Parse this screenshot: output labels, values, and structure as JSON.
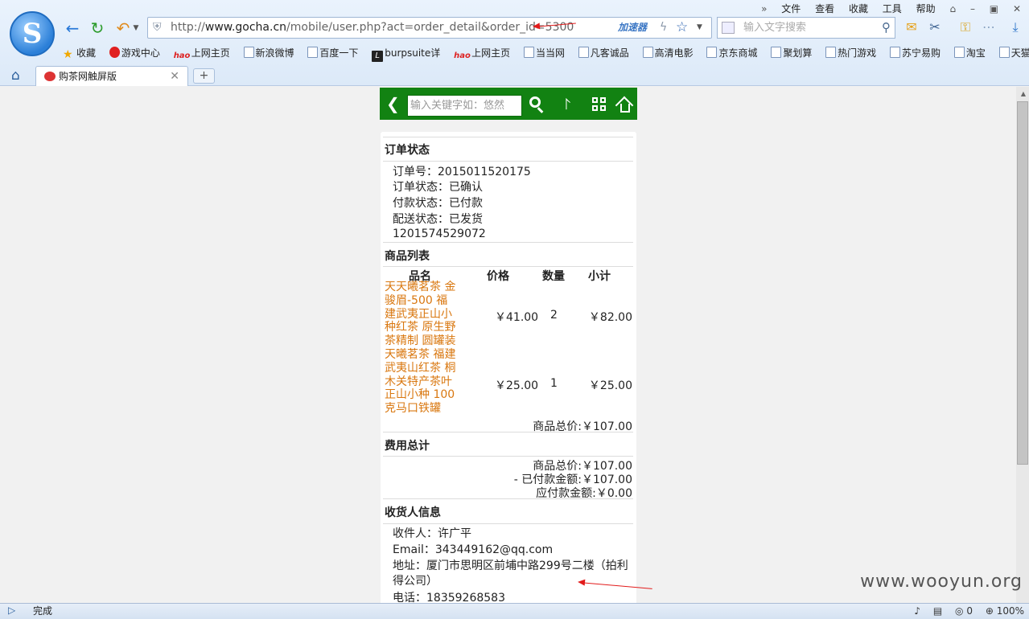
{
  "browser": {
    "logo_letter": "S",
    "url": {
      "scheme": "http://",
      "host": "www.gocha.cn",
      "path": "/mobile/user.php?act=order_detail&order_id=5300"
    },
    "accelerator_label": "加速器",
    "search_placeholder": "输入文字搜索",
    "menu": [
      "文件",
      "查看",
      "收藏",
      "工具",
      "帮助"
    ],
    "favorites": [
      {
        "label": "收藏",
        "icon": "star-icon"
      },
      {
        "label": "游戏中心",
        "icon": "game-icon"
      },
      {
        "label": "上网主页",
        "icon": "hao-icon"
      },
      {
        "label": "新浪微博",
        "icon": "page-icon"
      },
      {
        "label": "百度一下",
        "icon": "page-icon"
      },
      {
        "label": "burpsuite详",
        "icon": "burp-icon"
      },
      {
        "label": "上网主页",
        "icon": "hao-icon"
      },
      {
        "label": "当当网",
        "icon": "page-icon"
      },
      {
        "label": "凡客诚品",
        "icon": "page-icon"
      },
      {
        "label": "高清电影",
        "icon": "page-icon"
      },
      {
        "label": "京东商城",
        "icon": "page-icon"
      },
      {
        "label": "聚划算",
        "icon": "page-icon"
      },
      {
        "label": "热门游戏",
        "icon": "page-icon"
      },
      {
        "label": "苏宁易购",
        "icon": "page-icon"
      },
      {
        "label": "淘宝",
        "icon": "page-icon"
      },
      {
        "label": "天猫",
        "icon": "page-icon"
      }
    ],
    "tab_title": "购茶网触屏版",
    "status_text": "完成",
    "status_count": "0",
    "zoom": "100%"
  },
  "page": {
    "search_placeholder": "输入关键字如：悠然",
    "order_status": {
      "title": "订单状态",
      "order_no": "订单号：2015011520175",
      "order_state": "订单状态：已确认",
      "pay_state": "付款状态：已付款",
      "ship_state": "配送状态：已发货",
      "tracking": "1201574529072"
    },
    "goods": {
      "title": "商品列表",
      "headers": [
        "品名",
        "价格",
        "数量",
        "小计"
      ],
      "items": [
        {
          "name": "天天曦茗茶 金骏眉-500 福建武夷正山小种红茶 原生野茶精制 圆罐装",
          "price": "￥41.00",
          "qty": "2",
          "subtotal": "￥82.00"
        },
        {
          "name": "天曦茗茶 福建武夷山红茶 桐木关特产茶叶 正山小种 100克马口铁罐",
          "price": "￥25.00",
          "qty": "1",
          "subtotal": "￥25.00"
        }
      ],
      "total": "商品总价:￥107.00"
    },
    "fees": {
      "title": "费用总计",
      "goods_total": "商品总价:￥107.00",
      "paid": "- 已付款金额:￥107.00",
      "due": "应付款金额:￥0.00"
    },
    "consignee": {
      "title": "收货人信息",
      "name": "收件人：许广平",
      "email": "Email：343449162@qq.com",
      "address_1": "地址：厦门市思明区前埔中路299号二楼（拍利",
      "address_2": "得公司）",
      "phone": "电话：18359268583"
    }
  },
  "watermark": "www.wooyun.org",
  "colors": {
    "header_green": "#128212",
    "product_link": "#d9770f",
    "annotation_red": "#e21b1b"
  }
}
